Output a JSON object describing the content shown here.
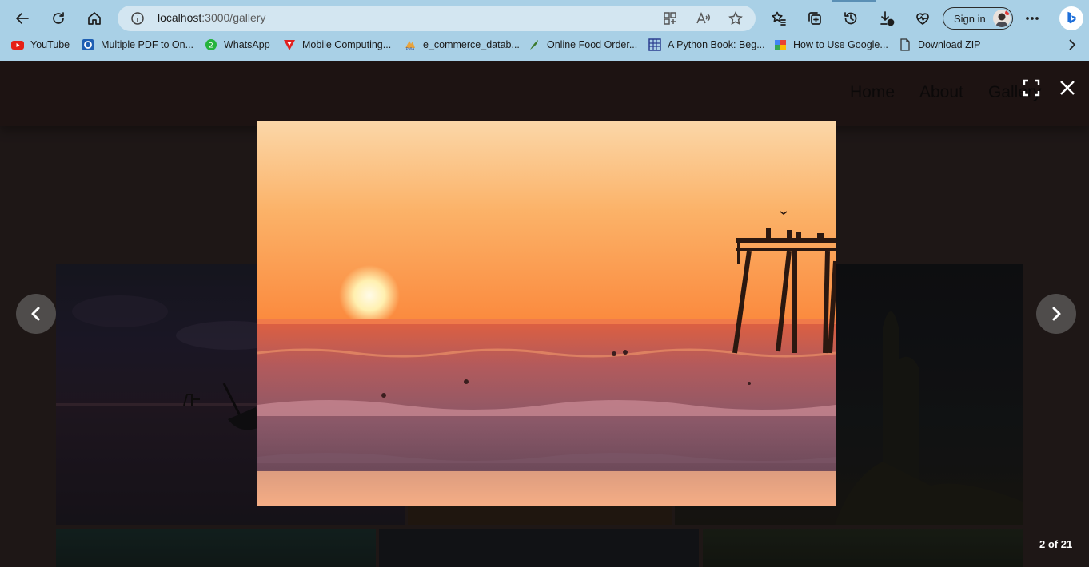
{
  "browser": {
    "url_host": "localhost",
    "url_rest": ":3000/gallery",
    "sign_in_label": "Sign in",
    "colors": {
      "chrome": "#a9d0e6",
      "omnibox": "#d3e6f1"
    }
  },
  "bookmarks": [
    {
      "label": "YouTube",
      "icon": "youtube-icon"
    },
    {
      "label": "Multiple PDF to On...",
      "icon": "pdf-converter-icon"
    },
    {
      "label": "WhatsApp",
      "icon": "whatsapp-icon"
    },
    {
      "label": "Mobile Computing...",
      "icon": "mobile-computing-icon"
    },
    {
      "label": "e_commerce_datab...",
      "icon": "phpmyadmin-icon"
    },
    {
      "label": "Online Food Order...",
      "icon": "feather-icon"
    },
    {
      "label": "A Python Book: Beg...",
      "icon": "grid-icon"
    },
    {
      "label": "How to Use Google...",
      "icon": "google-drive-icon"
    },
    {
      "label": "Download ZIP",
      "icon": "document-icon"
    }
  ],
  "site": {
    "nav": [
      "Home",
      "About",
      "Gallery"
    ]
  },
  "lightbox": {
    "counter": "2 of 21",
    "image_alt": "Sunset over ocean with pier"
  }
}
